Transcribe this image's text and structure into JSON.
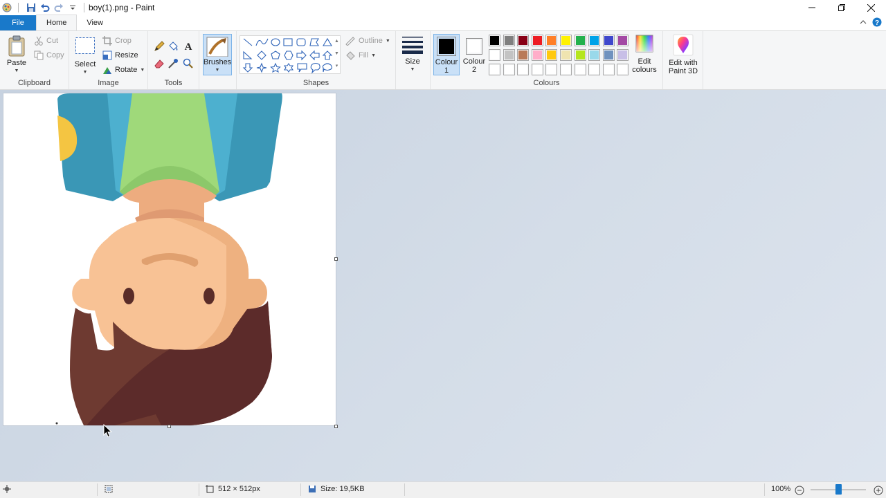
{
  "window": {
    "title": "boy(1).png - Paint"
  },
  "tabs": {
    "file": "File",
    "home": "Home",
    "view": "View"
  },
  "clipboard": {
    "paste": "Paste",
    "cut": "Cut",
    "copy": "Copy",
    "label": "Clipboard"
  },
  "image": {
    "select": "Select",
    "crop": "Crop",
    "resize": "Resize",
    "rotate": "Rotate",
    "label": "Image"
  },
  "tools": {
    "label": "Tools",
    "brushes": "Brushes"
  },
  "shapes": {
    "outline": "Outline",
    "fill": "Fill",
    "label": "Shapes"
  },
  "size": {
    "label": "Size"
  },
  "colours": {
    "colour1": "Colour",
    "colour1_num": "1",
    "colour2": "Colour",
    "colour2_num": "2",
    "edit": "Edit",
    "edit2": "colours",
    "label": "Colours",
    "paint3d": "Edit with",
    "paint3d2": "Paint 3D",
    "colour1_value": "#000000",
    "colour2_value": "#ffffff",
    "palette_row1": [
      "#000000",
      "#7f7f7f",
      "#880015",
      "#ed1c24",
      "#ff7f27",
      "#fff200",
      "#22b14c",
      "#00a2e8",
      "#3f48cc",
      "#a349a4"
    ],
    "palette_row2": [
      "#ffffff",
      "#c3c3c3",
      "#b97a57",
      "#ffaec9",
      "#ffc90e",
      "#efe4b0",
      "#b5e61d",
      "#99d9ea",
      "#7092be",
      "#c8bfe7"
    ]
  },
  "status": {
    "dimensions": "512 × 512px",
    "size": "Size: 19,5KB",
    "zoom": "100%",
    "zoom_level": 0.5
  }
}
